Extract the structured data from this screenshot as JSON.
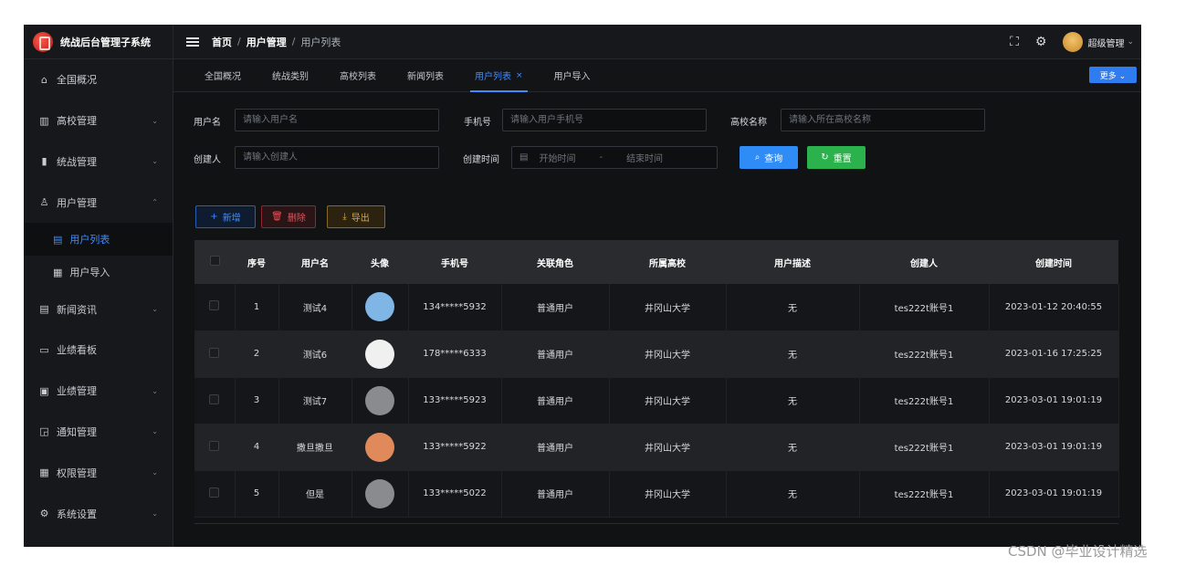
{
  "app": {
    "title": "统战后台管理子系统"
  },
  "sidebar": {
    "items": [
      {
        "label": "全国概况",
        "icon": "home-icon",
        "glyph": "⌂"
      },
      {
        "label": "高校管理",
        "icon": "building-icon",
        "glyph": "▥",
        "chevron": "⌄"
      },
      {
        "label": "统战管理",
        "icon": "chart-icon",
        "glyph": "▮",
        "chevron": "⌄"
      },
      {
        "label": "用户管理",
        "icon": "user-icon",
        "glyph": "♙",
        "chevron": "⌃"
      },
      {
        "label": "新闻资讯",
        "icon": "news-icon",
        "glyph": "▤",
        "chevron": "⌄"
      },
      {
        "label": "业绩看板",
        "icon": "board-icon",
        "glyph": "▭"
      },
      {
        "label": "业绩管理",
        "icon": "clipboard-icon",
        "glyph": "▣",
        "chevron": "⌄"
      },
      {
        "label": "通知管理",
        "icon": "notify-icon",
        "glyph": "◲",
        "chevron": "⌄"
      },
      {
        "label": "权限管理",
        "icon": "grid-icon",
        "glyph": "▦",
        "chevron": "⌄"
      },
      {
        "label": "系统设置",
        "icon": "gear-icon",
        "glyph": "⚙",
        "chevron": "⌄"
      }
    ],
    "sub_items": [
      {
        "label": "用户列表",
        "glyph": "▤"
      },
      {
        "label": "用户导入",
        "glyph": "▦"
      }
    ]
  },
  "header": {
    "breadcrumb": [
      "首页",
      "用户管理",
      "用户列表"
    ],
    "separator": "/",
    "user_name": "超级管理",
    "user_chevron": "⌄",
    "fullscreen_glyph": "⛶",
    "settings_glyph": "⚙"
  },
  "tabs": {
    "items": [
      "全国概况",
      "统战类别",
      "高校列表",
      "新闻列表",
      "用户列表",
      "用户导入"
    ],
    "active_close": "×",
    "more_label": "更多 ⌄"
  },
  "search": {
    "username_label": "用户名",
    "username_placeholder": "请输入用户名",
    "phone_label": "手机号",
    "phone_placeholder": "请输入用户手机号",
    "school_label": "高校名称",
    "school_placeholder": "请输入所在高校名称",
    "creator_label": "创建人",
    "creator_placeholder": "请输入创建人",
    "time_label": "创建时间",
    "start_placeholder": "开始时间",
    "range_dash": "-",
    "end_placeholder": "结束时间",
    "search_btn": "查询",
    "reset_btn": "重置",
    "search_glyph": "⌕",
    "reset_glyph": "↻"
  },
  "toolbar": {
    "add_label": "新增",
    "add_glyph": "+",
    "delete_label": "删除",
    "delete_glyph": "🗑",
    "export_label": "导出",
    "export_glyph": "⤓"
  },
  "table": {
    "headers": [
      "序号",
      "用户名",
      "头像",
      "手机号",
      "关联角色",
      "所属高校",
      "用户描述",
      "创建人",
      "创建时间"
    ],
    "rows": [
      {
        "no": "1",
        "name": "测试4",
        "avatar": "cartoon-boy",
        "avatar_color": "#7fb6e6",
        "phone": "134*****5932",
        "role": "普通用户",
        "school": "井冈山大学",
        "desc": "无",
        "creator": "tes222t账号1",
        "time": "2023-01-12 20:40:55"
      },
      {
        "no": "2",
        "name": "测试6",
        "avatar": "cartoon-girl",
        "avatar_color": "#f0f0f0",
        "phone": "178*****6333",
        "role": "普通用户",
        "school": "井冈山大学",
        "desc": "无",
        "creator": "tes222t账号1",
        "time": "2023-01-16 17:25:25"
      },
      {
        "no": "3",
        "name": "测试7",
        "avatar": "placeholder-gray",
        "avatar_color": "#8a8b8f",
        "phone": "133*****5923",
        "role": "普通用户",
        "school": "井冈山大学",
        "desc": "无",
        "creator": "tes222t账号1",
        "time": "2023-03-01 19:01:19"
      },
      {
        "no": "4",
        "name": "撒旦撒旦",
        "avatar": "mountain-sunset",
        "avatar_color": "#e08a5c",
        "phone": "133*****5922",
        "role": "普通用户",
        "school": "井冈山大学",
        "desc": "无",
        "creator": "tes222t账号1",
        "time": "2023-03-01 19:01:19"
      },
      {
        "no": "5",
        "name": "但是",
        "avatar": "placeholder-gray",
        "avatar_color": "#8a8b8f",
        "phone": "133*****5022",
        "role": "普通用户",
        "school": "井冈山大学",
        "desc": "无",
        "creator": "tes222t账号1",
        "time": "2023-03-01 19:01:19"
      }
    ]
  },
  "watermark": "CSDN @毕业设计精选",
  "colors": {
    "accent": "#3f8cff",
    "success": "#2bb24c",
    "danger": "#e2555c",
    "warning": "#e0aa36"
  }
}
